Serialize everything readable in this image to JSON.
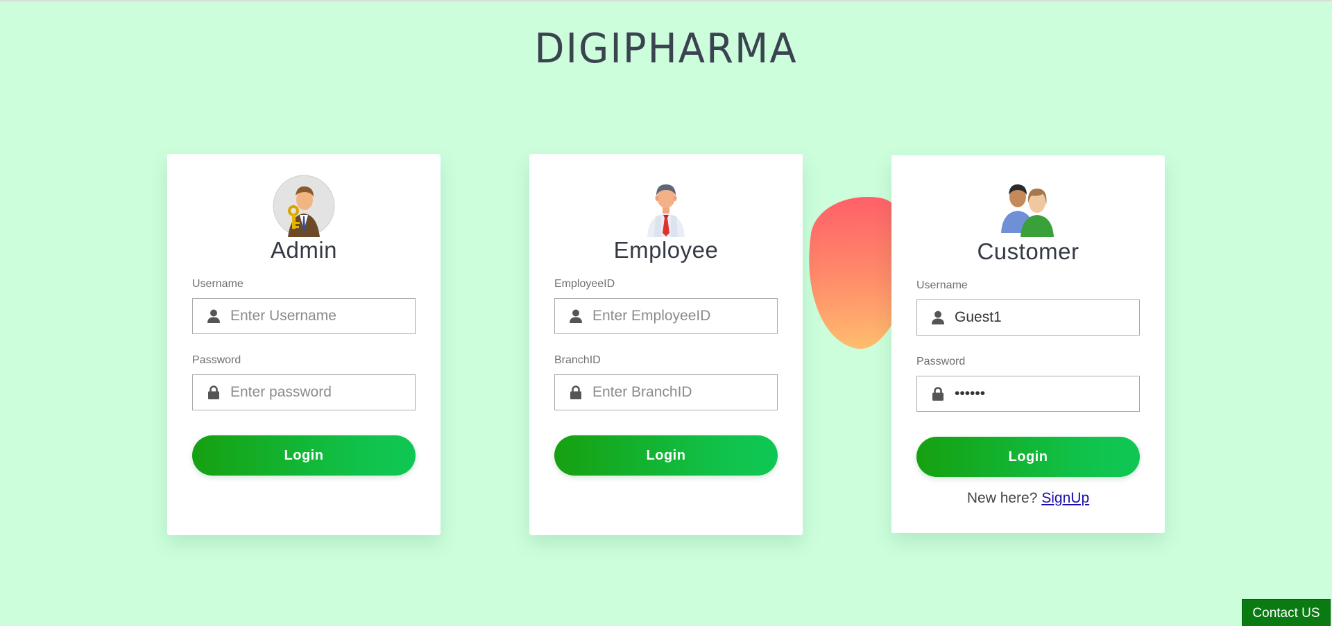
{
  "site": {
    "title": "DIGIPHARMA"
  },
  "cards": {
    "admin": {
      "title": "Admin",
      "field1": {
        "label": "Username",
        "placeholder": "Enter Username",
        "value": ""
      },
      "field2": {
        "label": "Password",
        "placeholder": "Enter password",
        "value": ""
      },
      "login_label": "Login"
    },
    "employee": {
      "title": "Employee",
      "field1": {
        "label": "EmployeeID",
        "placeholder": "Enter EmployeeID",
        "value": ""
      },
      "field2": {
        "label": "BranchID",
        "placeholder": "Enter BranchID",
        "value": ""
      },
      "login_label": "Login"
    },
    "customer": {
      "title": "Customer",
      "field1": {
        "label": "Username",
        "placeholder": "",
        "value": "Guest1"
      },
      "field2": {
        "label": "Password",
        "placeholder": "",
        "value": "••••••"
      },
      "login_label": "Login",
      "signup_prompt": "New here?",
      "signup_link": "SignUp"
    }
  },
  "contact": {
    "label": "Contact US"
  },
  "icons": {
    "user": "user-icon",
    "lock": "lock-icon"
  },
  "colors": {
    "background": "#ccfedc",
    "button_start": "#16a010",
    "button_end": "#0fc755",
    "contact_bg": "#0a7a12"
  }
}
